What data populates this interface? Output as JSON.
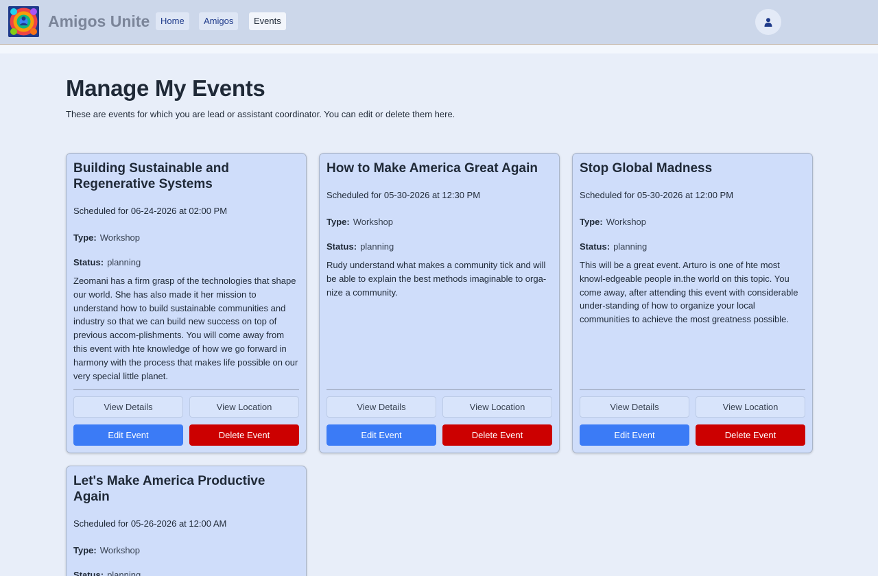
{
  "header": {
    "brand": "Amigos Unite",
    "nav": [
      {
        "label": "Home",
        "active": false
      },
      {
        "label": "Amigos",
        "active": false
      },
      {
        "label": "Events",
        "active": true
      }
    ]
  },
  "page": {
    "title": "Manage My Events",
    "description": "These are events for which you are lead or assistant coordinator. You can edit or delete them here."
  },
  "labels": {
    "type": "Type:",
    "status": "Status:",
    "view_details": "View Details",
    "view_location": "View Location",
    "edit": "Edit Event",
    "delete": "Delete Event"
  },
  "events": [
    {
      "title": "Building Sustainable and Regenerative Systems",
      "scheduled": "Scheduled for 06-24-2026 at 02:00 PM",
      "type": "Workshop",
      "status": "planning",
      "description": "Zeomani has a firm grasp of the technologies that shape our world. She has also made it her mission to understand how to build sustainable communities and industry so that we can build new success on top of previous accom-plishments. You will come away from this event with hte knowledge of how we go forward in harmony with the process that makes life possible on our very special little planet."
    },
    {
      "title": "How to Make America Great Again",
      "scheduled": "Scheduled for 05-30-2026 at 12:30 PM",
      "type": "Workshop",
      "status": "planning",
      "description": "Rudy understand what makes a community tick and will be able to explain the best methods imaginable to orga-nize a community."
    },
    {
      "title": "Stop Global Madness",
      "scheduled": "Scheduled for 05-30-2026 at 12:00 PM",
      "type": "Workshop",
      "status": "planning",
      "description": "This will be a great event. Arturo is one of hte most knowl-edgeable people in.the world on this topic. You come away, after attending this event with considerable under-standing of how to organize your local communities to achieve the most greatness possible."
    },
    {
      "title": "Let's Make America Productive Again",
      "scheduled": "Scheduled for 05-26-2026 at 12:00 AM",
      "type": "Workshop",
      "status": "planning",
      "description": ""
    }
  ],
  "colors": {
    "header_bg": "#ccd7ea",
    "card_bg": "#cfddfa",
    "edit_button": "#3b7bf6",
    "delete_button": "#cc0000"
  },
  "icons": {
    "logo": "amigos-logo-icon",
    "profile": "user-icon"
  }
}
